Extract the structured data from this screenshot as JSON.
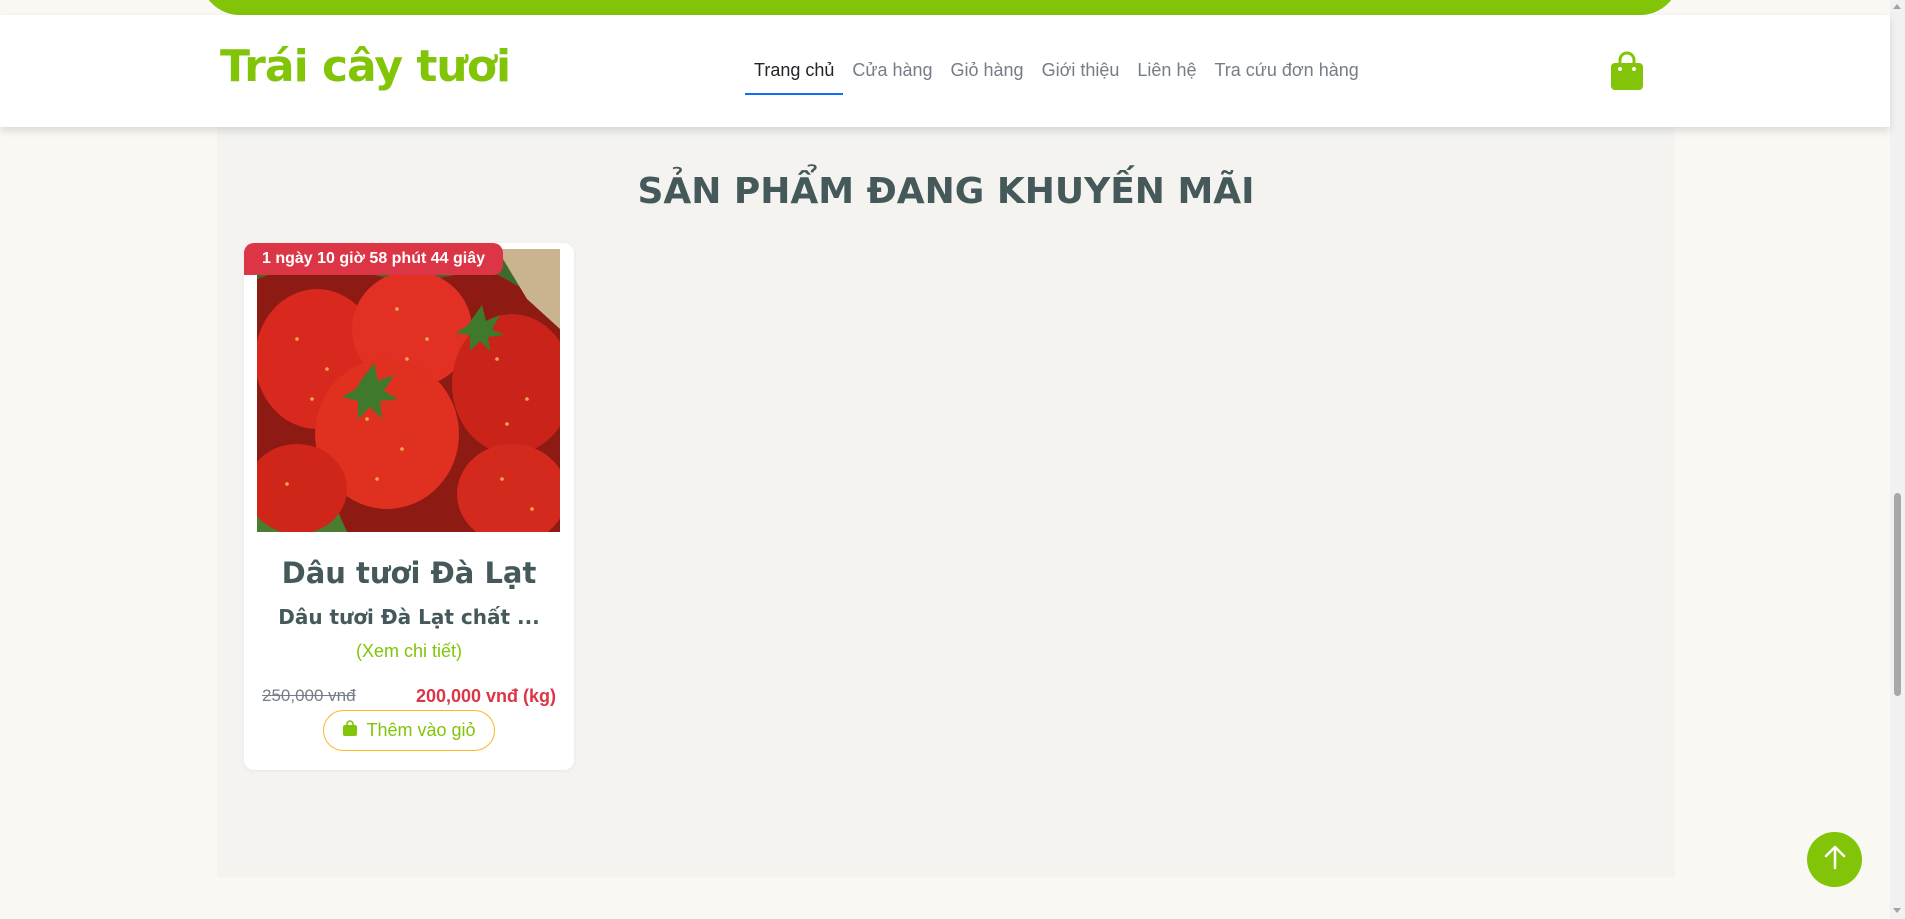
{
  "brand": "Trái cây tươi",
  "nav": [
    {
      "label": "Trang chủ",
      "active": true
    },
    {
      "label": "Cửa hàng"
    },
    {
      "label": "Giỏ hàng"
    },
    {
      "label": "Giới thiệu"
    },
    {
      "label": "Liên hệ"
    },
    {
      "label": "Tra cứu đơn hàng"
    }
  ],
  "section": {
    "title": "SẢN PHẨM ĐANG KHUYẾN MÃI"
  },
  "product": {
    "countdown": "1 ngày 10 giờ 58 phút 44 giây",
    "name": "Dâu tươi Đà Lạt",
    "description": "Dâu tươi Đà Lạt chất ...",
    "detail_link": "(Xem chi tiết)",
    "old_price": "250,000 vnđ",
    "new_price": "200,000 vnđ (kg)",
    "add_to_cart": "Thêm vào giỏ"
  },
  "colors": {
    "brand_green": "#81c408",
    "sale_red": "#dc3545",
    "heading": "#45595b",
    "outline_yellow": "#ffb524"
  },
  "icons": {
    "cart": "shopping-bag-icon",
    "back_to_top": "arrow-up-icon"
  }
}
